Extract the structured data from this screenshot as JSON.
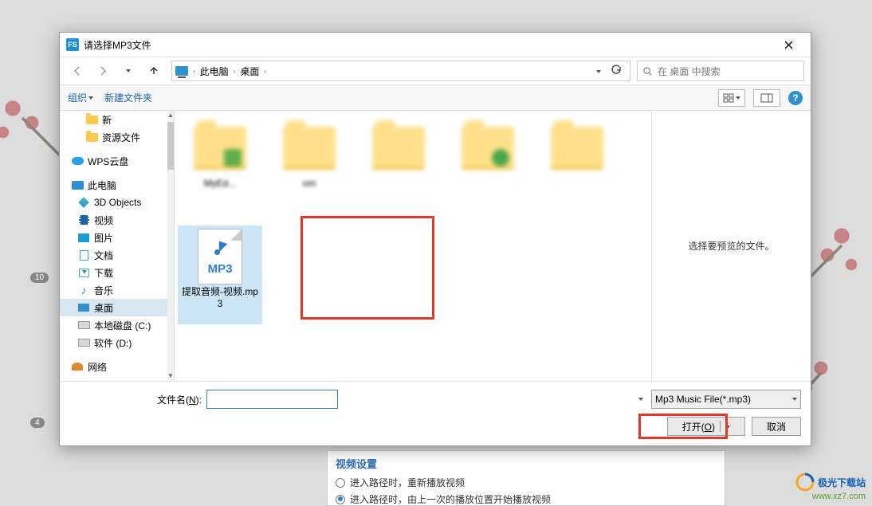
{
  "dialog": {
    "title": "请选择MP3文件",
    "appicon_text": "FS"
  },
  "nav": {
    "crumb1": "此电脑",
    "crumb2": "桌面",
    "search_placeholder": "在 桌面 中搜索"
  },
  "toolbar": {
    "organize": "组织",
    "new_folder": "新建文件夹"
  },
  "sidebar": {
    "items": [
      {
        "label": "新",
        "type": "folder-y",
        "lvl": "l3"
      },
      {
        "label": "资源文件",
        "type": "folder-y",
        "lvl": "l3"
      },
      {
        "label": "WPS云盘",
        "type": "cloud-b",
        "lvl": "l1"
      },
      {
        "label": "此电脑",
        "type": "pc-b",
        "lvl": "l1"
      },
      {
        "label": "3D Objects",
        "type": "cube-t",
        "lvl": ""
      },
      {
        "label": "视频",
        "type": "film",
        "lvl": ""
      },
      {
        "label": "图片",
        "type": "pic",
        "lvl": ""
      },
      {
        "label": "文档",
        "type": "doc",
        "lvl": ""
      },
      {
        "label": "下载",
        "type": "dl",
        "lvl": ""
      },
      {
        "label": "音乐",
        "type": "note",
        "lvl": ""
      },
      {
        "label": "桌面",
        "type": "desk",
        "lvl": "",
        "selected": true
      },
      {
        "label": "本地磁盘 (C:)",
        "type": "drive",
        "lvl": ""
      },
      {
        "label": "软件 (D:)",
        "type": "drive",
        "lvl": ""
      },
      {
        "label": "网络",
        "type": "net",
        "lvl": "l1"
      }
    ]
  },
  "files": {
    "folders": [
      {
        "label": "MyEd..."
      },
      {
        "label": "om"
      },
      {
        "label": ""
      },
      {
        "label": ""
      },
      {
        "label": ""
      }
    ],
    "selected_mp3": {
      "label": "提取音频-视频.mp3",
      "badge": "MP3"
    }
  },
  "preview": {
    "empty_text": "选择要预览的文件。"
  },
  "footer": {
    "filename_label_pre": "文件名(",
    "filename_label_key": "N",
    "filename_label_post": "):",
    "filter": "Mp3 Music File(*.mp3)",
    "open_pre": "打开(",
    "open_key": "O",
    "open_post": ")",
    "cancel": "取消"
  },
  "under": {
    "header": "视频设置",
    "opt1": "进入路径时，重新播放视频",
    "opt2": "进入路径时，由上一次的播放位置开始播放视频"
  },
  "watermark": {
    "line1": "极光下载站",
    "line2": "www.xz7.com"
  },
  "anno": {
    "n10": "10",
    "n4": "4"
  }
}
